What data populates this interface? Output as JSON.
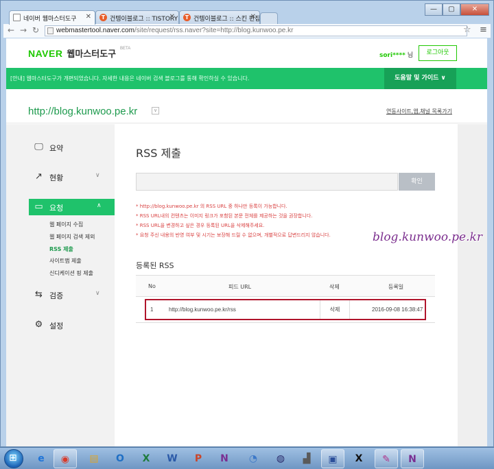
{
  "browser": {
    "tabs": [
      {
        "title": "네이버 웹마스터도구",
        "active": true
      },
      {
        "title": "건텡이블로그 :: TISTORY",
        "active": false
      },
      {
        "title": "건텡이블로그 :: 스킨 편집",
        "active": false
      }
    ],
    "url_host": "webmastertool.naver.com",
    "url_rest": "/site/request/rss.naver?site=http://blog.kunwoo.pe.kr",
    "close_symbol": "✕",
    "minimize_symbol": "—",
    "maximize_symbol": "▢"
  },
  "header": {
    "brand": "NAVER",
    "product": "웹마스터도구",
    "beta": "BETA",
    "user_name": "sori****",
    "user_suffix": " 님",
    "logout_label": "로그아웃"
  },
  "notice": {
    "text": "[안내] 웹마스터도구가 개편되었습니다. 자세한 내용은 네이버 검색 블로그를 통해 확인하실 수 있습니다.",
    "guide_label": "도움말 및 가이드 ∨"
  },
  "site": {
    "url": "http://blog.kunwoo.pe.kr",
    "list_link": "연동사이트,앱,채널 목록가기"
  },
  "sidebar": {
    "items": [
      {
        "label": "요약",
        "icon": "monitor-icon"
      },
      {
        "label": "현황",
        "icon": "chart-icon"
      },
      {
        "label": "요청",
        "icon": "folder-icon"
      },
      {
        "label": "검증",
        "icon": "sync-icon"
      },
      {
        "label": "설정",
        "icon": "gear-icon"
      }
    ],
    "sub_items": [
      "웹 페이지 수집",
      "웹 페이지 검색 제외",
      "RSS 제출",
      "사이트맵 제출",
      "신디케이션 핑 제출"
    ]
  },
  "content": {
    "title": "RSS 제출",
    "input_value": "",
    "confirm_label": "확인",
    "tips": [
      "* http://blog.kunwoo.pe.kr 의 RSS URL 중 하나만 등록이 가능합니다.",
      "* RSS URL내의 컨텐츠는 이미지 링크가 포함된 본문 전체를 제공하는 것을 권장합니다.",
      "* RSS URL을 변경하고 싶은 경우 등록된 URL을 삭제해주세요.",
      "* 요청 주신 내용의 반영 여부 및 시기는 보장해 드릴 수 없으며, 개별적으로 답변드리지 않습니다."
    ],
    "watermark": "blog.kunwoo.pe.kr",
    "registered_title": "등록된 RSS",
    "table": {
      "headers": [
        "No",
        "피드 URL",
        "삭제",
        "등록일"
      ],
      "rows": [
        {
          "no": "1",
          "url": "http://blog.kunwoo.pe.kr/rss",
          "delete": "삭제",
          "date": "2016-09-08 16:38:47"
        }
      ]
    }
  },
  "taskbar": {
    "apps": [
      "ie-icon",
      "chrome-icon",
      "explorer-icon",
      "outlook-icon",
      "excel-icon",
      "word-icon",
      "powerpoint-icon",
      "onenote-icon",
      "app-icon",
      "app-icon",
      "app-icon",
      "app-icon",
      "app-icon",
      "app-icon",
      "onenote-icon"
    ],
    "app_glyphs": [
      "e",
      "◉",
      "▤",
      "O",
      "X",
      "W",
      "P",
      "N",
      "◔",
      "◍",
      "▟",
      "▣",
      "X",
      "✎",
      "N"
    ]
  },
  "colors": {
    "naver_green": "#1ec800",
    "notice_green": "#1fc26b",
    "highlight_red": "#b0142b",
    "tip_red": "#d83f3f",
    "watermark": "#7b2e8e"
  }
}
